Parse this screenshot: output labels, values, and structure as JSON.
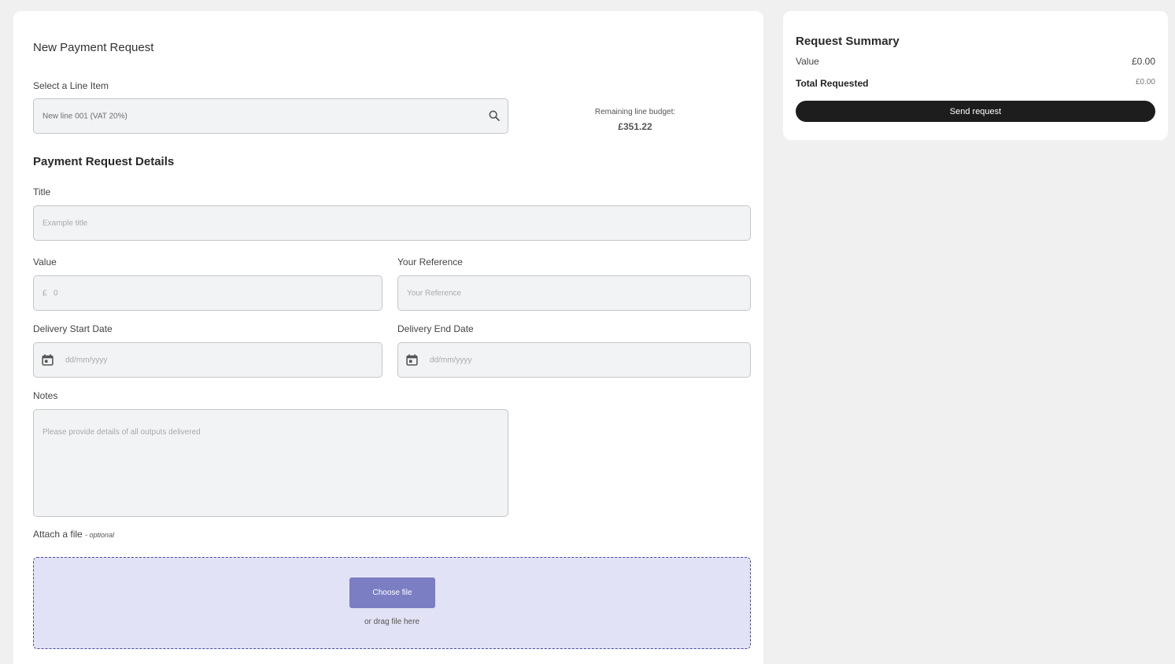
{
  "form": {
    "title": "New Payment Request",
    "line_item_label": "Select a Line Item",
    "line_item_value": "New line 001 (VAT 20%)",
    "budget_label": "Remaining line budget:",
    "budget_value": "£351.22",
    "details_title": "Payment Request Details",
    "title_label": "Title",
    "title_placeholder": "Example title",
    "value_label": "Value",
    "value_currency": "£",
    "value_placeholder": "0",
    "reference_label": "Your Reference",
    "reference_placeholder": "Your Reference",
    "start_date_label": "Delivery Start Date",
    "start_date_placeholder": "dd/mm/yyyy",
    "end_date_label": "Delivery End Date",
    "end_date_placeholder": "dd/mm/yyyy",
    "notes_label": "Notes",
    "notes_placeholder": "Please provide details of all outputs delivered",
    "attach_label": "Attach a file",
    "attach_optional": "- optional",
    "choose_file": "Choose file",
    "drag_text": "or drag file here"
  },
  "summary": {
    "title": "Request Summary",
    "value_label": "Value",
    "value_amount": "£0.00",
    "total_label": "Total Requested",
    "total_amount": "£0.00",
    "send_button": "Send request"
  },
  "icons": {
    "search": "search-icon",
    "calendar": "calendar-icon"
  },
  "colors": {
    "accent": "#7b7ec3",
    "drop_zone_bg": "#e2e2f6",
    "send_button_bg": "#1d1d1d"
  }
}
